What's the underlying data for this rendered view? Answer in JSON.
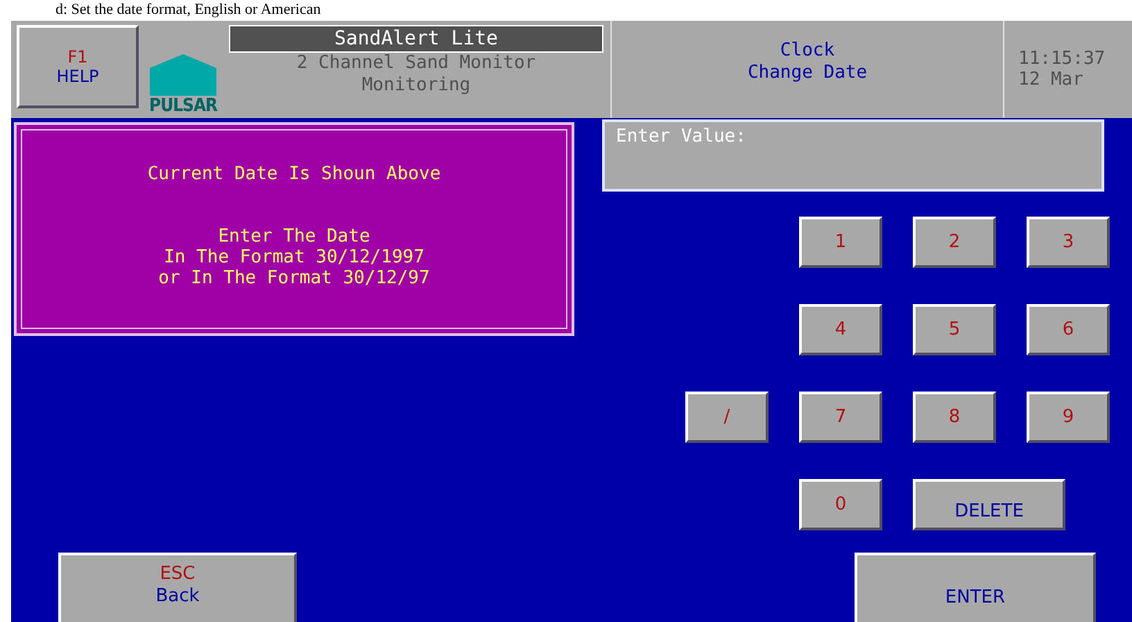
{
  "caption": "d: Set the date format, English or American",
  "header": {
    "help_button": {
      "key": "F1",
      "label": "HELP"
    },
    "logo": "PULSAR",
    "title": "SandAlert Lite",
    "subtitle": [
      "2 Channel Sand Monitor",
      "Monitoring"
    ],
    "screen": [
      "Clock",
      "Change Date"
    ],
    "time": "11:15:37",
    "date": "12 Mar"
  },
  "info_panel": {
    "heading": "Current Date Is Shoun Above",
    "lines": [
      "Enter The Date",
      "In The Format 30/12/1997",
      "or In The Format 30/12/97"
    ]
  },
  "input": {
    "label": "Enter Value:"
  },
  "keypad": [
    {
      "label": "1",
      "kind": "digit"
    },
    {
      "label": "2",
      "kind": "digit"
    },
    {
      "label": "3",
      "kind": "digit"
    },
    {
      "label": "4",
      "kind": "digit"
    },
    {
      "label": "5",
      "kind": "digit"
    },
    {
      "label": "6",
      "kind": "digit"
    },
    {
      "label": "/",
      "kind": "digit"
    },
    {
      "label": "7",
      "kind": "digit"
    },
    {
      "label": "8",
      "kind": "digit"
    },
    {
      "label": "9",
      "kind": "digit"
    },
    {
      "label": "0",
      "kind": "digit"
    },
    {
      "label": "DELETE",
      "kind": "command"
    }
  ],
  "back_button": {
    "key": "ESC",
    "label": "Back"
  },
  "enter_button": {
    "label": "ENTER"
  }
}
